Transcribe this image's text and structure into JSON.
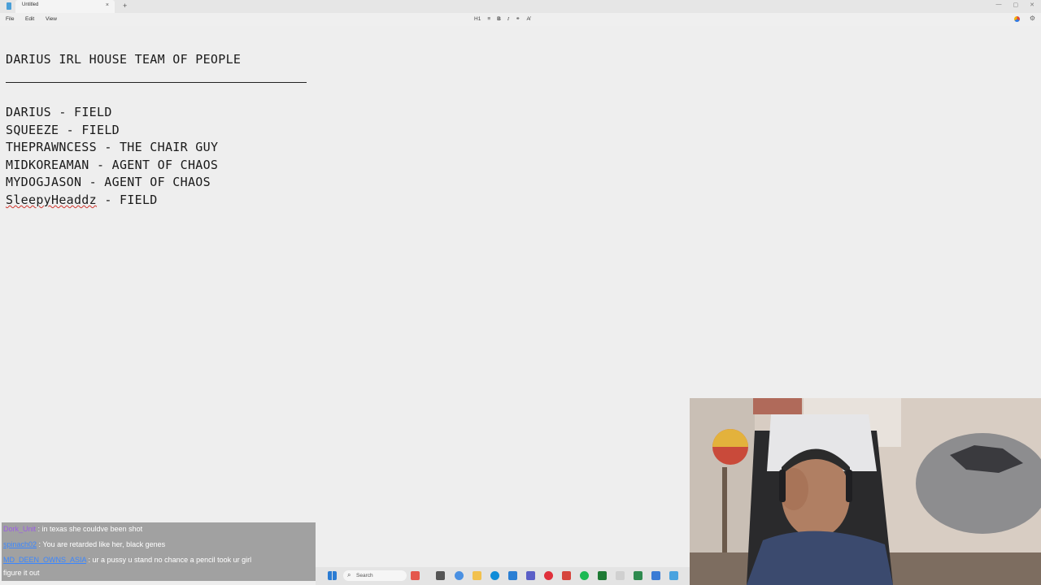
{
  "window": {
    "tab_title": "Untitled",
    "tab_close_glyph": "×",
    "new_tab_glyph": "+",
    "controls": [
      "—",
      "▢",
      "✕"
    ]
  },
  "menu": {
    "file": "File",
    "edit": "Edit",
    "view": "View"
  },
  "toolbar": {
    "heading": "H1",
    "list_glyph": "≡",
    "bold": "B",
    "italic": "I",
    "link_glyph": "⚭",
    "clear_glyph": "A̸",
    "settings_glyph": "⚙"
  },
  "document": {
    "title": "DARIUS IRL HOUSE TEAM OF PEOPLE",
    "lines": [
      {
        "name": "DARIUS",
        "role": " - FIELD"
      },
      {
        "name": "SQUEEZE",
        "role": " - FIELD"
      },
      {
        "name": "THEPRAWNCESS",
        "role": " - THE CHAIR GUY"
      },
      {
        "name": "MIDKOREAMAN",
        "role": " - AGENT OF CHAOS"
      },
      {
        "name": "MYDOGJASON",
        "role": " - AGENT OF CHAOS"
      },
      {
        "name": "SleepyHeaddz",
        "role": " - FIELD"
      }
    ]
  },
  "chat": {
    "messages": [
      {
        "user": "Dork_Unit",
        "text": " : in texas she couldve been shot"
      },
      {
        "user": "spinach02",
        "text": " : You are retarded like her, black genes"
      },
      {
        "user": "MD_DEEN_OWNS_ASIA",
        "text": " : ur a pussy u stand no chance a pencil took ur girl"
      },
      {
        "user": "",
        "text": "figure it out"
      }
    ]
  },
  "taskbar": {
    "search_placeholder": "Search",
    "search_glyph": "⌕",
    "icons": [
      {
        "name": "start-icon",
        "color": "#2b7cd3"
      },
      {
        "name": "widgets-icon",
        "color": "#e4574c"
      },
      {
        "name": "task-view-icon",
        "color": "#555555"
      },
      {
        "name": "chrome-icon",
        "color": "#4a90e2"
      },
      {
        "name": "file-explorer-icon",
        "color": "#f2c14e"
      },
      {
        "name": "edge-icon",
        "color": "#0f8cd8"
      },
      {
        "name": "store-icon",
        "color": "#2a7fd4"
      },
      {
        "name": "teams-icon",
        "color": "#5b5fc7"
      },
      {
        "name": "opera-icon",
        "color": "#e0303b"
      },
      {
        "name": "app-red-icon",
        "color": "#d6453d"
      },
      {
        "name": "spotify-icon",
        "color": "#1db954"
      },
      {
        "name": "terminal-icon",
        "color": "#1e7a34"
      },
      {
        "name": "notepad-icon",
        "color": "#d0d0d0"
      },
      {
        "name": "calculator-icon",
        "color": "#2f8a4f"
      },
      {
        "name": "snipping-icon",
        "color": "#3a7bd5"
      },
      {
        "name": "app-blue-icon",
        "color": "#4aa3df"
      }
    ]
  }
}
